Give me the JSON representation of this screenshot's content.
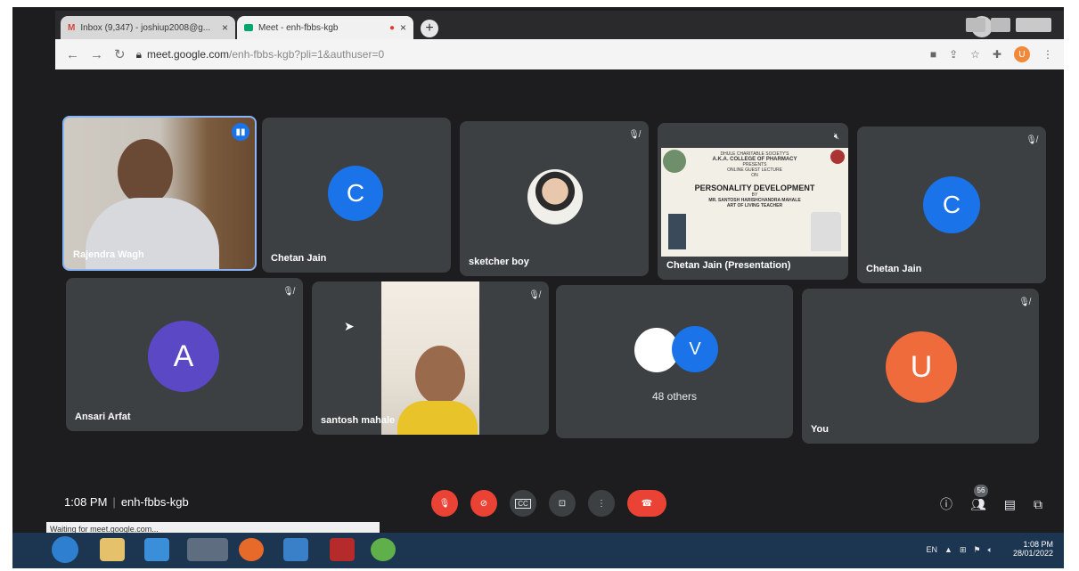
{
  "browser": {
    "tabs": [
      {
        "label": "Inbox (9,347) - joshiup2008@g...",
        "icon": "gmail-icon"
      },
      {
        "label": "Meet - enh-fbbs-kgb",
        "icon": "meet-icon"
      }
    ],
    "url": {
      "domain": "meet.google.com",
      "path": "/enh-fbbs-kgb?pli=1&authuser=0"
    },
    "profile_initial": "U"
  },
  "participants": [
    {
      "name": "Rajendra Wagh",
      "type": "video"
    },
    {
      "name": "Chetan Jain",
      "initial": "C",
      "color": "#1a73e8"
    },
    {
      "name": "sketcher boy",
      "type": "photo"
    },
    {
      "name": "Chetan Jain (Presentation)",
      "type": "presentation"
    },
    {
      "name": "Chetan Jain",
      "initial": "C",
      "color": "#1a73e8"
    },
    {
      "name": "Ansari Arfat",
      "initial": "A",
      "color": "#5b48c4"
    },
    {
      "name": "santosh mahale",
      "type": "video"
    },
    {
      "others_label": "48 others",
      "initial": "V",
      "color": "#1a73e8"
    },
    {
      "name": "You",
      "initial": "U",
      "color": "#f06b3c"
    }
  ],
  "presentation": {
    "line1": "DHULE CHARITABLE SOCIETY'S",
    "line2": "A.K.A. COLLEGE OF PHARMACY",
    "line3": "PRESENTS",
    "line4": "ONLINE GUEST LECTURE",
    "line5": "ON",
    "title": "PERSONALITY DEVELOPMENT",
    "by": "BY",
    "speaker": "MR. SANTOSH HARISHCHANDRA MAHALE",
    "role": "ART OF LIVING TEACHER"
  },
  "meeting": {
    "time": "1:08 PM",
    "code": "enh-fbbs-kgb"
  },
  "status_text": "Waiting for meet.google.com...",
  "controls": {
    "cc": "CC",
    "people_count": "56"
  },
  "taskbar": {
    "lang": "EN",
    "time": "1:08 PM",
    "date": "28/01/2022"
  }
}
